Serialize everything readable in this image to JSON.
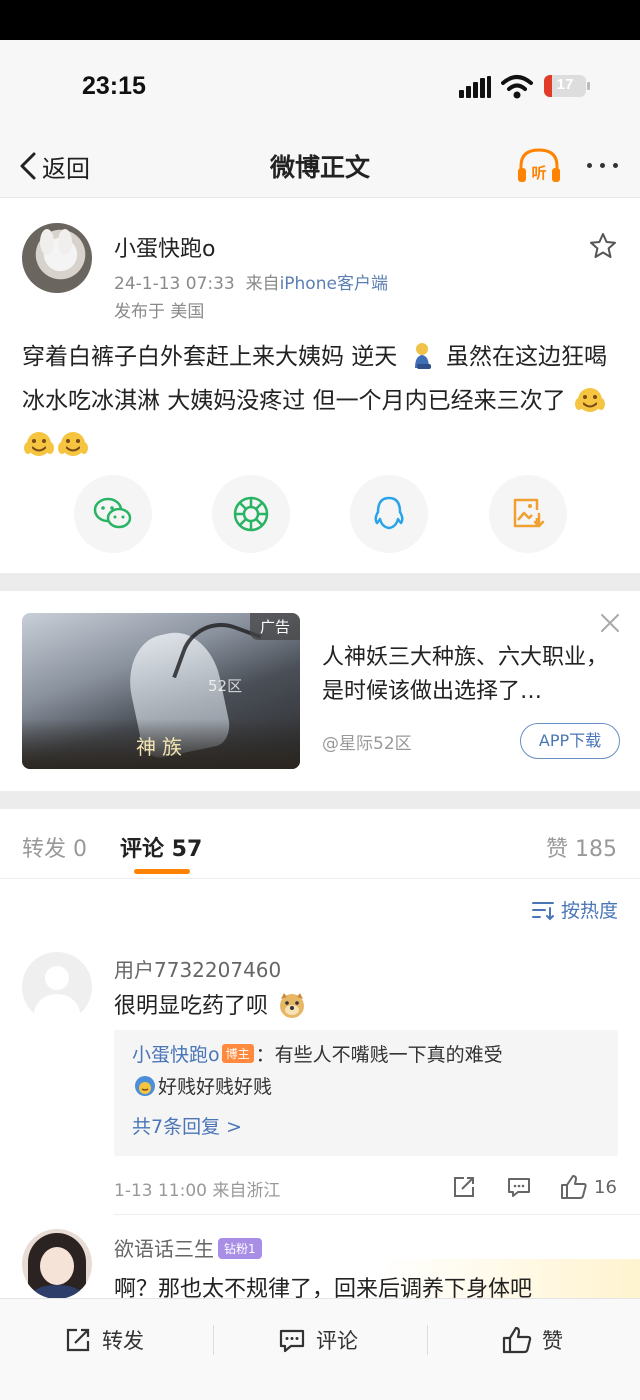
{
  "status_bar": {
    "time": "23:15",
    "battery_level": "17",
    "battery_color": "#e23b2a"
  },
  "nav": {
    "back_label": "返回",
    "title": "微博正文",
    "listen_label": "听"
  },
  "post": {
    "username": "小蛋快跑o",
    "timestamp": "24-1-13 07:33",
    "source_prefix": "来自",
    "source": "iPhone客户端",
    "location": "发布于 美国",
    "text_part1": "穿着白裤子白外套赶上来大姨妈 逆天",
    "text_part2": "虽然在这边狂喝冰水吃冰淇淋 大姨妈没疼过 但一个月内已经来三次了",
    "share_targets": [
      "wechat-icon",
      "moments-icon",
      "qq-icon",
      "save-image-icon"
    ]
  },
  "ad": {
    "tag": "广告",
    "watermark": "52区",
    "game_logo": "神族",
    "text": "人神妖三大种族、六大职业，是时候该做出选择了…",
    "source": "@星际52区",
    "button": "APP下载"
  },
  "tabs": {
    "repost": "转发 0",
    "comment": "评论 57",
    "like": "赞 185",
    "accent_color": "#ff8200"
  },
  "sort": {
    "label": "按热度"
  },
  "comments": [
    {
      "user": "用户7732207460",
      "text": "很明显吃药了呗",
      "reply": {
        "name": "小蛋快跑o",
        "badge": "博主",
        "text": "：有些人不嘴贱一下真的难受",
        "text2": "好贱好贱好贱",
        "more": "共7条回复 >"
      },
      "time": "1-13 11:00",
      "location": "来自浙江",
      "likes": "16"
    },
    {
      "user": "欲语话三生",
      "badge": "钻粉1",
      "text": "啊？那也太不规律了，回来后调养下身体吧"
    }
  ],
  "bottom_bar": {
    "repost": "转发",
    "comment": "评论",
    "like": "赞"
  },
  "link_color": "#4a76b8"
}
